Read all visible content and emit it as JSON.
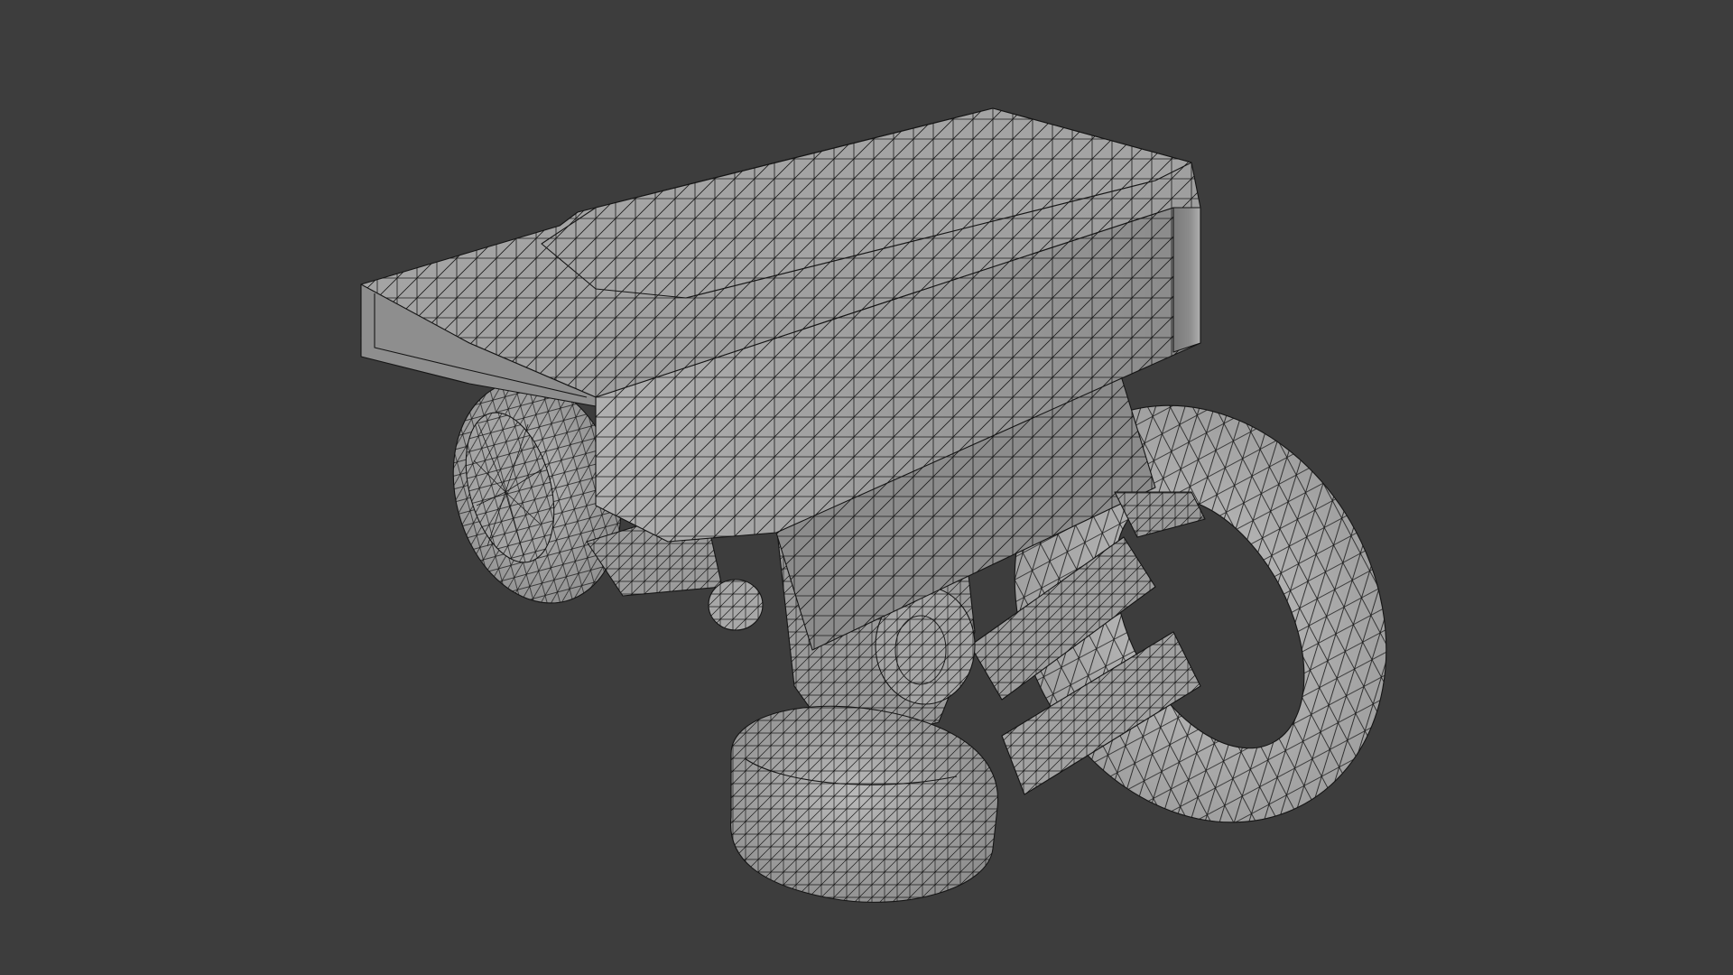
{
  "viewport": {
    "background_color": "#3d3d3d",
    "shading": "solid-with-wireframe",
    "object": "3d-mesh-model"
  },
  "colors": {
    "mesh_base": "#9a9a9a",
    "mesh_light": "#b4b4b4",
    "mesh_dark": "#6e6e6e",
    "wireframe": "#151515"
  }
}
